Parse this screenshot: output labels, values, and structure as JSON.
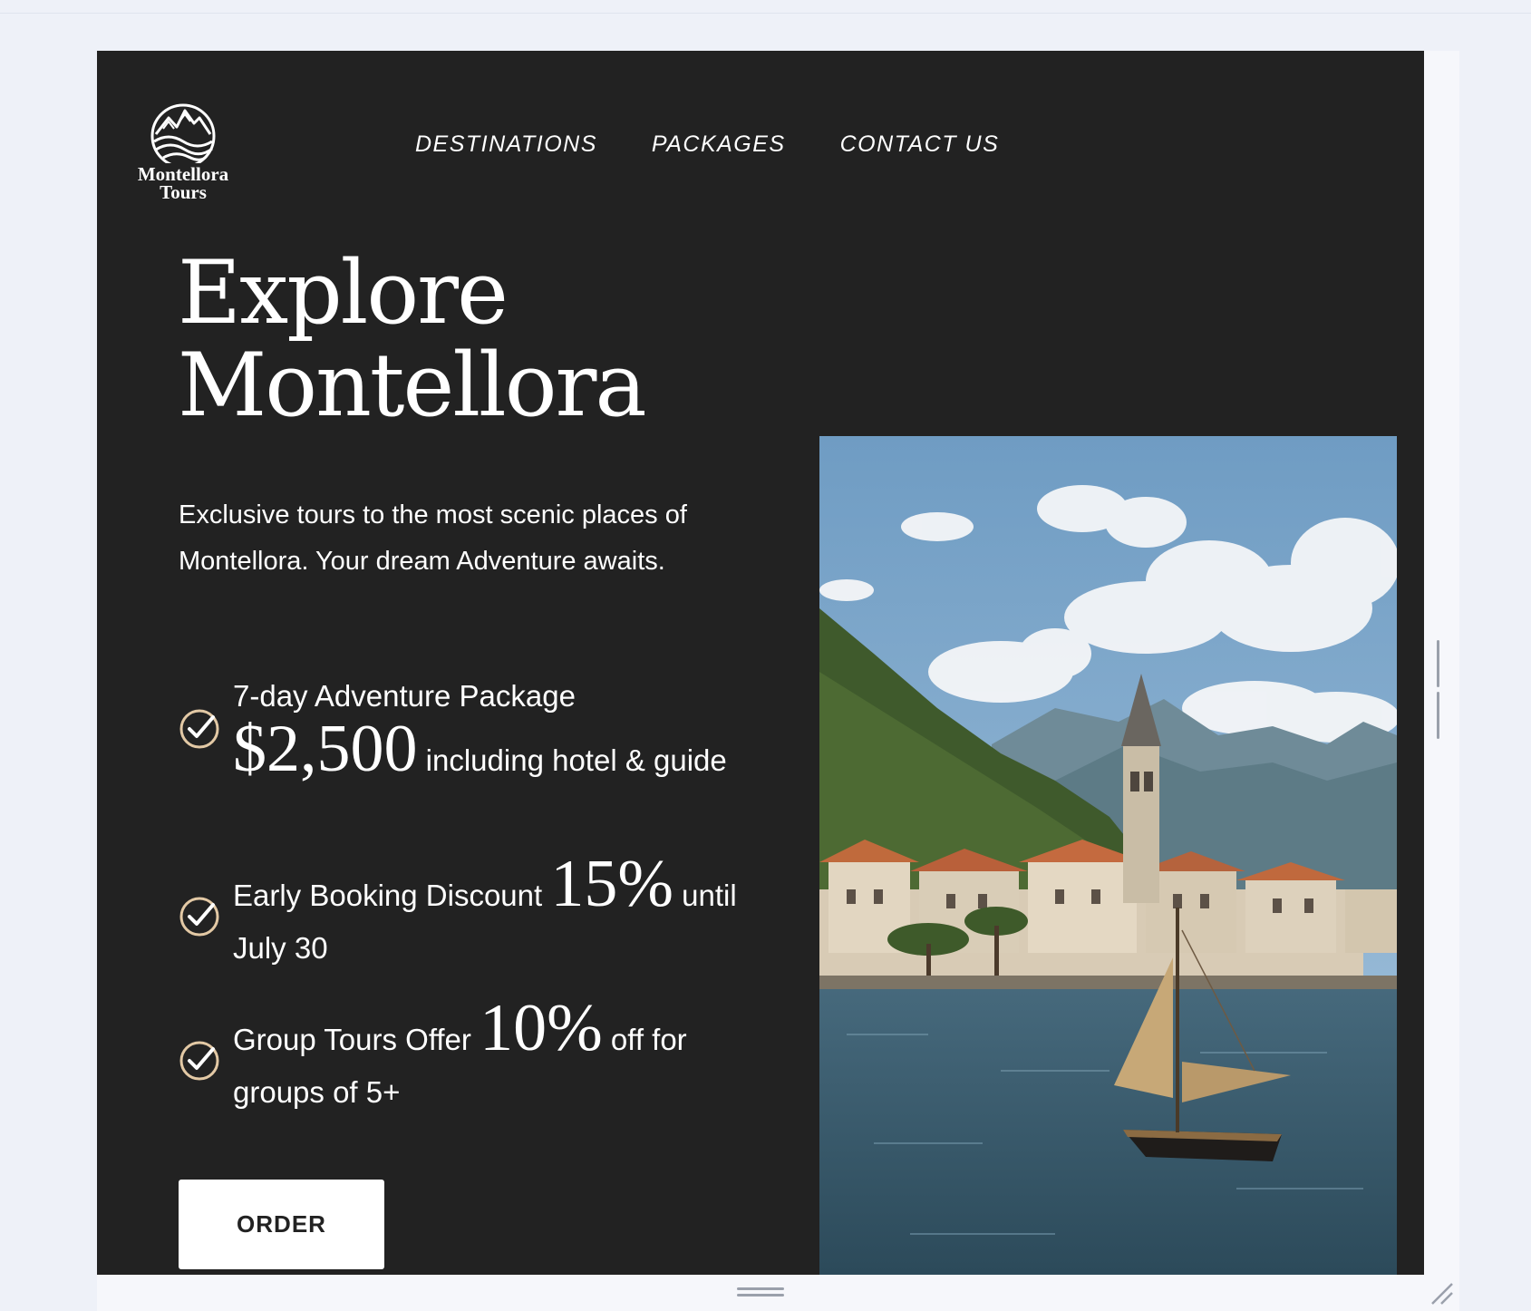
{
  "brand": {
    "name_line1": "Montellora",
    "name_line2": "Tours",
    "logo_icon": "mountains-waves-icon"
  },
  "nav": {
    "items": [
      {
        "label": "DESTINATIONS"
      },
      {
        "label": "PACKAGES"
      },
      {
        "label": "CONTACT US"
      }
    ]
  },
  "hero": {
    "title_line1": "Explore",
    "title_line2": "Montellora",
    "intro": "Exclusive tours to the most scenic places of Montellora. Your dream Adventure awaits.",
    "image_alt": "Coastal town on a bay with a bell tower, mountains, and a sailboat"
  },
  "features": [
    {
      "pre": "7-day Adventure Package",
      "highlight": "$2,500",
      "post": " including hotel & guide",
      "icon": "check-circle-icon"
    },
    {
      "pre": "Early Booking Discount ",
      "highlight": "15%",
      "post": " until July 30",
      "icon": "check-circle-icon"
    },
    {
      "pre": "Group Tours Offer ",
      "highlight": "10%",
      "post": " off for groups of 5+",
      "icon": "check-circle-icon"
    }
  ],
  "cta": {
    "order_label": "ORDER"
  },
  "colors": {
    "hero_bg": "#222222",
    "text": "#ffffff",
    "check_accent": "#e3c9a5",
    "page_bg": "#eef1f8"
  }
}
